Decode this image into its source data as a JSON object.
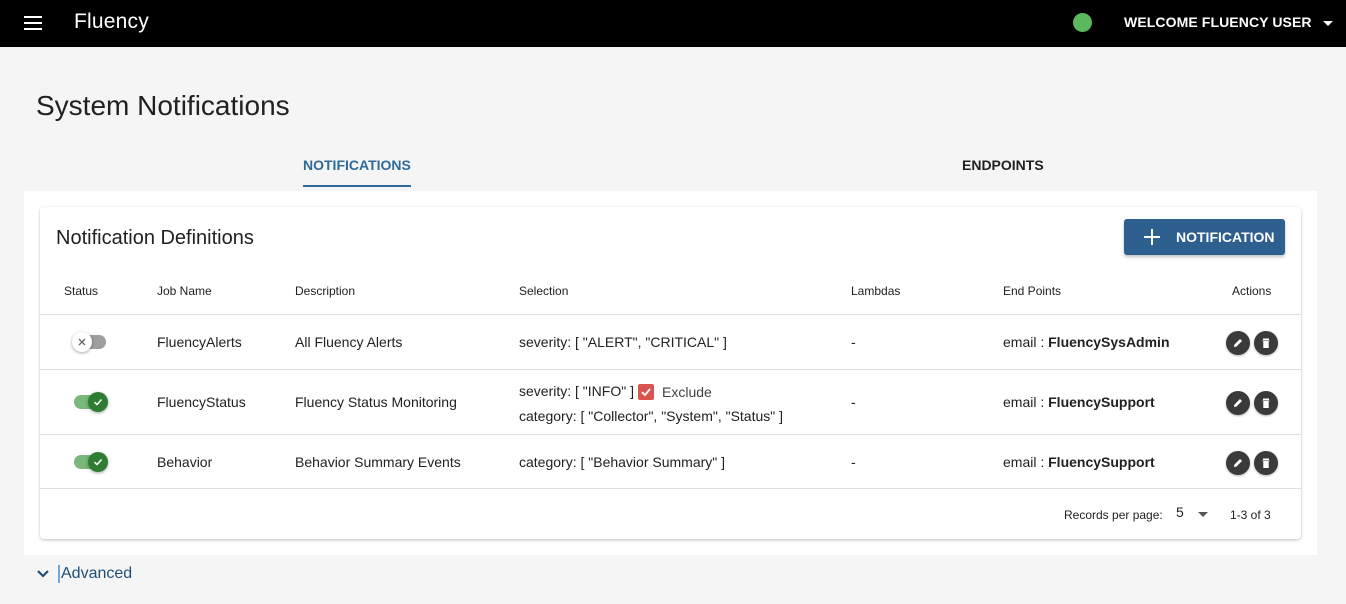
{
  "app": {
    "title": "Fluency",
    "user_menu": "WELCOME FLUENCY USER",
    "status_color": "#5cb85c"
  },
  "page": {
    "title": "System Notifications"
  },
  "tabs": [
    {
      "label": "NOTIFICATIONS",
      "active": true
    },
    {
      "label": "ENDPOINTS",
      "active": false
    }
  ],
  "card": {
    "title": "Notification Definitions",
    "add_button": "NOTIFICATION"
  },
  "table": {
    "headers": {
      "status": "Status",
      "job_name": "Job Name",
      "description": "Description",
      "selection": "Selection",
      "lambdas": "Lambdas",
      "end_points": "End Points",
      "actions": "Actions"
    },
    "rows": [
      {
        "enabled": false,
        "job_name": "FluencyAlerts",
        "description": "All Fluency Alerts",
        "selection": "severity: [ \"ALERT\", \"CRITICAL\" ]",
        "lambdas": "-",
        "endpoint_type": "email : ",
        "endpoint_name": "FluencySysAdmin"
      },
      {
        "enabled": true,
        "job_name": "FluencyStatus",
        "description": "Fluency Status Monitoring",
        "selection": "severity: [ \"INFO\" ]",
        "exclude_label": "Exclude",
        "exclude_checked": true,
        "selection_line2": "category: [ \"Collector\", \"System\", \"Status\" ]",
        "lambdas": "-",
        "endpoint_type": "email : ",
        "endpoint_name": "FluencySupport"
      },
      {
        "enabled": true,
        "job_name": "Behavior",
        "description": "Behavior Summary Events",
        "selection": "category: [ \"Behavior Summary\" ]",
        "lambdas": "-",
        "endpoint_type": "email : ",
        "endpoint_name": "FluencySupport"
      }
    ]
  },
  "pagination": {
    "label": "Records per page:",
    "per_page": "5",
    "range": "1-3 of 3"
  },
  "advanced": {
    "label": "Advanced"
  },
  "icons": [
    "menu-icon",
    "caret-down-icon",
    "plus-icon",
    "close-icon",
    "check-icon",
    "pencil-icon",
    "trash-icon",
    "chevron-down-icon"
  ]
}
